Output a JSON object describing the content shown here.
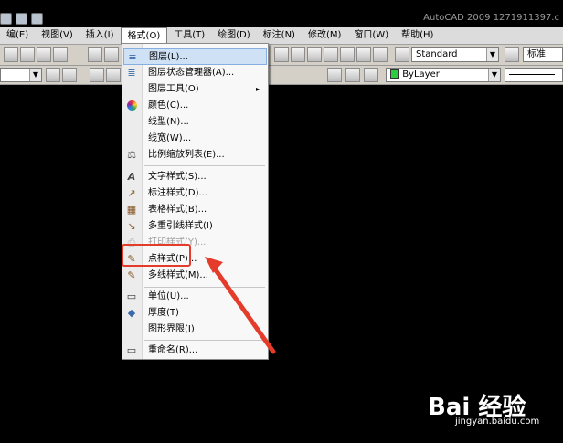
{
  "app": {
    "title": "AutoCAD 2009  1271911397.c"
  },
  "menubar": {
    "items": [
      "编(E)",
      "视图(V)",
      "插入(I)",
      "格式(O)",
      "工具(T)",
      "绘图(D)",
      "标注(N)",
      "修改(M)",
      "窗口(W)",
      "帮助(H)"
    ],
    "active": "格式(O)"
  },
  "toolbar": {
    "text_style_value": "Standard",
    "dim_style_value": "标准",
    "color_value": "ByLayer"
  },
  "format_menu": {
    "items": [
      {
        "label": "图层(L)...",
        "icon": "layer-icon",
        "highlighted": true
      },
      {
        "label": "图层状态管理器(A)...",
        "icon": "layer-state-icon"
      },
      {
        "label": "图层工具(O)",
        "icon": "",
        "submenu": true
      },
      {
        "label": "颜色(C)...",
        "icon": "color-wheel-icon"
      },
      {
        "label": "线型(N)...",
        "icon": ""
      },
      {
        "label": "线宽(W)...",
        "icon": ""
      },
      {
        "label": "比例缩放列表(E)...",
        "icon": "scale-list-icon"
      },
      {
        "label": "文字样式(S)...",
        "icon": "text-style-icon"
      },
      {
        "label": "标注样式(D)...",
        "icon": "dim-style-icon"
      },
      {
        "label": "表格样式(B)...",
        "icon": "table-style-icon"
      },
      {
        "label": "多重引线样式(I)",
        "icon": "mleader-style-icon"
      },
      {
        "label": "打印样式(Y)...",
        "icon": "plot-style-icon",
        "disabled": true
      },
      {
        "label": "点样式(P)...",
        "icon": "point-style-icon"
      },
      {
        "label": "多线样式(M)...",
        "icon": "mline-style-icon"
      },
      {
        "label": "单位(U)...",
        "icon": "units-icon"
      },
      {
        "label": "厚度(T)",
        "icon": "thickness-icon"
      },
      {
        "label": "图形界限(I)",
        "icon": ""
      },
      {
        "label": "重命名(R)...",
        "icon": "rename-icon"
      }
    ],
    "submenu_glyph": "▸"
  },
  "watermark": {
    "brand": "Bai 经验",
    "url": "jingyan.baidu.com"
  }
}
